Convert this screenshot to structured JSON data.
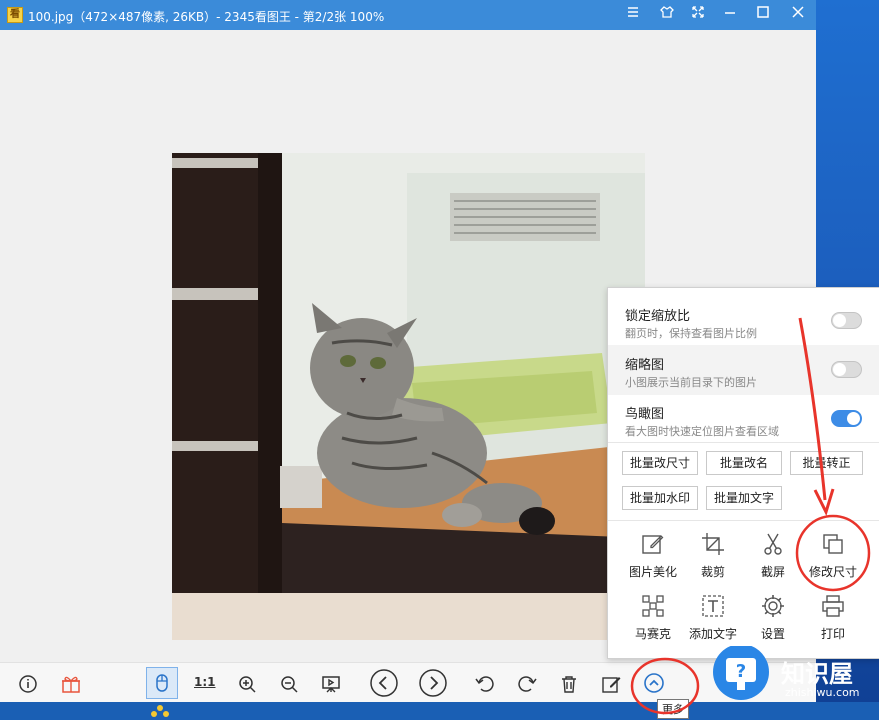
{
  "window": {
    "title": "100.jpg（472×487像素, 26KB）- 2345看图王 - 第2/2张 100%",
    "app_icon": "看",
    "controls": [
      "menu-icon",
      "skin-icon",
      "fullscreen-icon",
      "minimize-icon",
      "maximize-icon",
      "close-icon"
    ]
  },
  "panel": {
    "options": [
      {
        "title": "锁定缩放比",
        "subtitle": "翻页时，保持查看图片比例",
        "on": false
      },
      {
        "title": "缩略图",
        "subtitle": "小图展示当前目录下的图片",
        "on": false
      },
      {
        "title": "鸟瞰图",
        "subtitle": "看大图时快速定位图片查看区域",
        "on": true
      }
    ],
    "batch_buttons": [
      "批量改尺寸",
      "批量改名",
      "批量转正",
      "批量加水印",
      "批量加文字"
    ],
    "tools": [
      {
        "label": "图片美化",
        "icon": "edit-icon"
      },
      {
        "label": "裁剪",
        "icon": "crop-icon"
      },
      {
        "label": "截屏",
        "icon": "scissors-icon"
      },
      {
        "label": "修改尺寸",
        "icon": "resize-icon"
      },
      {
        "label": "马赛克",
        "icon": "mosaic-icon"
      },
      {
        "label": "添加文字",
        "icon": "text-icon"
      },
      {
        "label": "设置",
        "icon": "gear-icon"
      },
      {
        "label": "打印",
        "icon": "print-icon"
      }
    ]
  },
  "toolbar": {
    "actual_size_label": "1:1",
    "more_tooltip": "更多"
  },
  "watermark": {
    "brand": "知识屋",
    "site": "zhishiwu.com"
  },
  "colors": {
    "titlebar": "#3b8bd9",
    "toggle_on": "#3d8ce6",
    "annotation": "#e8342b"
  }
}
